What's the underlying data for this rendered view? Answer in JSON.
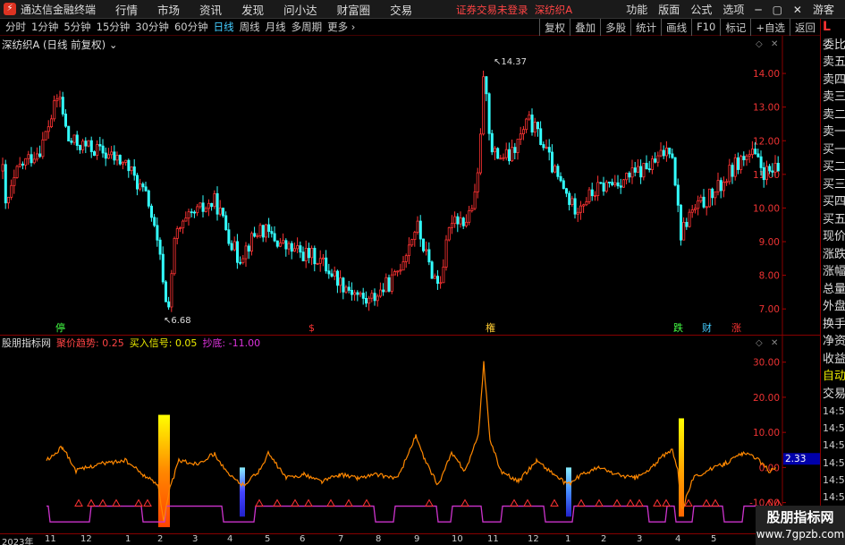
{
  "titlebar": {
    "app_name": "通达信金融终端",
    "menu": [
      "行情",
      "市场",
      "资讯",
      "发现",
      "问小达",
      "财富圈",
      "交易"
    ],
    "notice": "证券交易未登录",
    "stock": "深纺织A",
    "right": [
      "功能",
      "版面",
      "公式",
      "选项"
    ],
    "user": "游客"
  },
  "periodbar": {
    "periods": [
      "分时",
      "1分钟",
      "5分钟",
      "15分钟",
      "30分钟",
      "60分钟",
      "日线",
      "周线",
      "月线",
      "多周期",
      "更多"
    ],
    "active": "日线",
    "tools": [
      "复权",
      "叠加",
      "多股",
      "统计",
      "画线",
      "F10",
      "标记",
      "+自选",
      "返回"
    ]
  },
  "main": {
    "title": "深纺织A (日线 前复权)",
    "high_marker": "14.37",
    "low_marker": "6.68",
    "event_tags": [
      "停",
      "$",
      "権",
      "跌",
      "财",
      "涨"
    ]
  },
  "sub": {
    "name": "股朋指标网",
    "trend_label": "聚价趋势:",
    "trend_value": "0.25",
    "buy_label": "买入信号:",
    "buy_value": "0.05",
    "bottom_label": "抄底:",
    "bottom_value": "-11.00",
    "current_value": "2.33"
  },
  "right_panel": {
    "top": "L",
    "items": [
      "委比",
      "卖五",
      "卖四",
      "卖三",
      "卖二",
      "卖一",
      "买一",
      "买二",
      "买三",
      "买四",
      "买五",
      "现价",
      "涨跌",
      "涨幅",
      "总量",
      "外盘",
      "换手",
      "净资",
      "收益"
    ],
    "auto": "自动",
    "trade": "交易",
    "times": [
      "14:56",
      "14:56",
      "14:56",
      "14:56",
      "14:56",
      "14:56",
      "14:56",
      "14:56",
      "14:56"
    ]
  },
  "date_axis": {
    "labels": [
      "2023年",
      "11",
      "12",
      "1",
      "2",
      "3",
      "4",
      "5",
      "6",
      "7",
      "8",
      "9",
      "10",
      "11",
      "12",
      "1",
      "2",
      "3",
      "4",
      "5"
    ]
  },
  "watermark": {
    "line1": "股朋指标网",
    "line2": "www.7gpzb.com"
  },
  "chart_data": [
    {
      "type": "candlestick",
      "title": "深纺织A (日线 前复权)",
      "ylim": [
        6.5,
        14.8
      ],
      "y_ticks": [
        7.0,
        8.0,
        9.0,
        10.0,
        11.0,
        12.0,
        13.0,
        14.0
      ],
      "max": 14.37,
      "min": 6.68,
      "colors": {
        "up": "#ff3333",
        "down": "#33ffff"
      }
    },
    {
      "type": "line",
      "title": "股朋指标网",
      "ylim": [
        -18,
        34
      ],
      "y_ticks": [
        -10.0,
        0.0,
        10.0,
        20.0,
        30.0
      ],
      "series": [
        {
          "name": "聚价趋势",
          "color": "#ff8800"
        },
        {
          "name": "抄底",
          "color": "#cc33cc"
        }
      ]
    }
  ]
}
